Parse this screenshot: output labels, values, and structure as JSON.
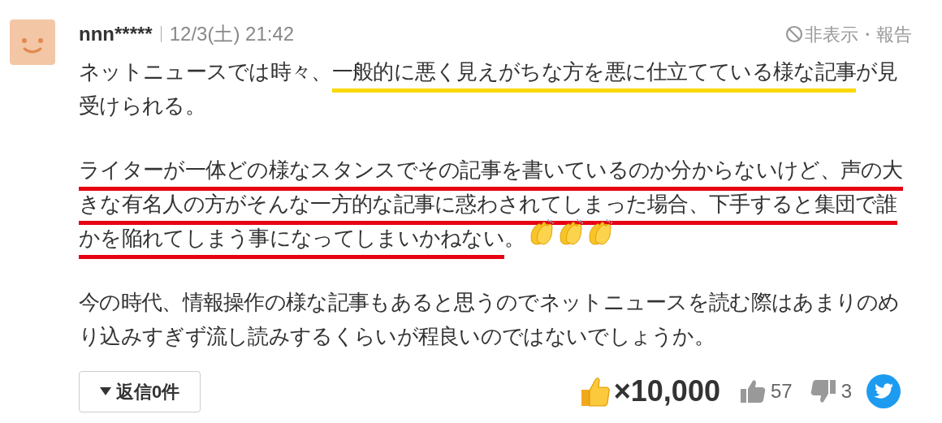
{
  "comment": {
    "user": "nnn*****",
    "date": "12/3(土) 21:42",
    "hide_report": "非表示・報告",
    "paragraphs": [
      {
        "segments": [
          {
            "text": "ネットニュースでは時々、"
          },
          {
            "text": "一般的に悪く見えがちな方を悪に仕立てている様な記事",
            "color": "#fbd800"
          },
          {
            "text": "が見受けられる。"
          }
        ]
      },
      {
        "segments": [
          {
            "text": "ライターが一体どの様なスタンスでその記事を書いているのか分からないけど、声の大きな有名人の方がそんな一方的な記事に惑わされてしまった場合、下手すると集団で誰かを陥れてしまう事になってしまいかねない",
            "color": "#e60012"
          },
          {
            "text": "。"
          }
        ],
        "stickers": [
          {
            "kind": "clap"
          },
          {
            "kind": "clap"
          },
          {
            "kind": "clap"
          }
        ]
      },
      {
        "segments": [
          {
            "text": "今の時代、情報操作の様な記事もあると思うのでネットニュースを読む際はあまりのめり込みすぎず流し読みするくらいが程良いのではないでしょうか。"
          }
        ]
      }
    ],
    "reply_button": "返信0件",
    "big_count": "×10,000",
    "likes": "57",
    "dislikes": "3"
  }
}
